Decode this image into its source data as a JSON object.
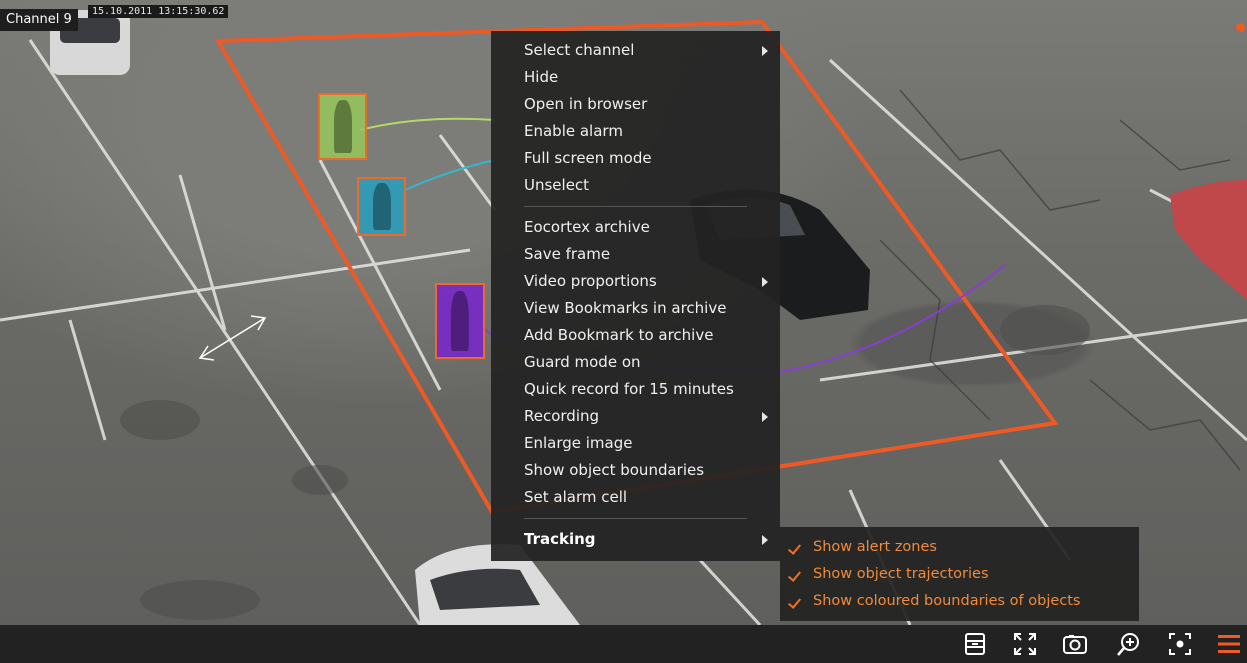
{
  "camera": {
    "channel_label": "Channel 9",
    "timestamp": "15.10.2011 13:15:30.62"
  },
  "menu": {
    "groups": [
      [
        {
          "label": "Select channel",
          "submenu": true
        },
        {
          "label": "Hide"
        },
        {
          "label": "Open in browser"
        },
        {
          "label": "Enable alarm"
        },
        {
          "label": "Full screen mode"
        },
        {
          "label": "Unselect"
        }
      ],
      [
        {
          "label": "Eocortex archive"
        },
        {
          "label": "Save frame"
        },
        {
          "label": "Video proportions",
          "submenu": true
        },
        {
          "label": "View Bookmarks in archive"
        },
        {
          "label": "Add Bookmark to archive"
        },
        {
          "label": "Guard mode on"
        },
        {
          "label": "Quick record for 15 minutes"
        },
        {
          "label": "Recording",
          "submenu": true
        },
        {
          "label": "Enlarge image"
        },
        {
          "label": "Show object boundaries"
        },
        {
          "label": "Set alarm cell"
        }
      ],
      [
        {
          "label": "Tracking",
          "submenu": true,
          "active": true
        }
      ]
    ]
  },
  "tracking_submenu": [
    {
      "label": "Show alert zones",
      "checked": true
    },
    {
      "label": "Show object trajectories",
      "checked": true
    },
    {
      "label": "Show coloured boundaries of objects",
      "checked": true
    }
  ],
  "toolbar": {
    "buttons": [
      "archive-icon",
      "fullscreen-icon",
      "camera-snapshot-icon",
      "zoom-in-icon",
      "focus-icon",
      "menu-icon"
    ]
  },
  "colors": {
    "accent": "#f05a23",
    "menu_bg": "#222222",
    "alert_zone": "#ee5a25"
  }
}
